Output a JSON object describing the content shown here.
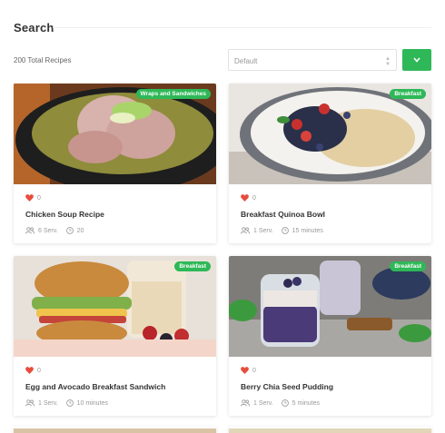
{
  "header": {
    "title": "Search"
  },
  "results": {
    "total_label": "200 Total Recipes"
  },
  "sort": {
    "selected": "Default",
    "button_icon": "chevron-down-icon"
  },
  "colors": {
    "accent": "#2eb857",
    "heart": "#e74c3c"
  },
  "recipes": [
    {
      "category": "Wraps and Sandwiches",
      "likes": "0",
      "title": "Chicken Soup Recipe",
      "servings": "6 Serv.",
      "time": "20"
    },
    {
      "category": "Breakfast",
      "likes": "0",
      "title": "Breakfast Quinoa Bowl",
      "servings": "1 Serv.",
      "time": "15 minutes"
    },
    {
      "category": "Breakfast",
      "likes": "0",
      "title": "Egg and Avocado Breakfast Sandwich",
      "servings": "1 Serv.",
      "time": "10 minutes"
    },
    {
      "category": "Breakfast",
      "likes": "0",
      "title": "Berry Chia Seed Pudding",
      "servings": "1 Serv.",
      "time": "5 minutes"
    }
  ]
}
